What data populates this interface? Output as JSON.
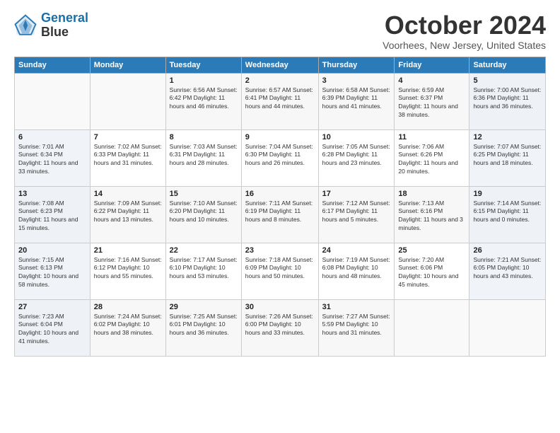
{
  "header": {
    "logo_line1": "General",
    "logo_line2": "Blue",
    "month": "October 2024",
    "location": "Voorhees, New Jersey, United States"
  },
  "days_of_week": [
    "Sunday",
    "Monday",
    "Tuesday",
    "Wednesday",
    "Thursday",
    "Friday",
    "Saturday"
  ],
  "weeks": [
    [
      {
        "day": "",
        "info": ""
      },
      {
        "day": "",
        "info": ""
      },
      {
        "day": "1",
        "info": "Sunrise: 6:56 AM\nSunset: 6:42 PM\nDaylight: 11 hours and 46 minutes."
      },
      {
        "day": "2",
        "info": "Sunrise: 6:57 AM\nSunset: 6:41 PM\nDaylight: 11 hours and 44 minutes."
      },
      {
        "day": "3",
        "info": "Sunrise: 6:58 AM\nSunset: 6:39 PM\nDaylight: 11 hours and 41 minutes."
      },
      {
        "day": "4",
        "info": "Sunrise: 6:59 AM\nSunset: 6:37 PM\nDaylight: 11 hours and 38 minutes."
      },
      {
        "day": "5",
        "info": "Sunrise: 7:00 AM\nSunset: 6:36 PM\nDaylight: 11 hours and 36 minutes."
      }
    ],
    [
      {
        "day": "6",
        "info": "Sunrise: 7:01 AM\nSunset: 6:34 PM\nDaylight: 11 hours and 33 minutes."
      },
      {
        "day": "7",
        "info": "Sunrise: 7:02 AM\nSunset: 6:33 PM\nDaylight: 11 hours and 31 minutes."
      },
      {
        "day": "8",
        "info": "Sunrise: 7:03 AM\nSunset: 6:31 PM\nDaylight: 11 hours and 28 minutes."
      },
      {
        "day": "9",
        "info": "Sunrise: 7:04 AM\nSunset: 6:30 PM\nDaylight: 11 hours and 26 minutes."
      },
      {
        "day": "10",
        "info": "Sunrise: 7:05 AM\nSunset: 6:28 PM\nDaylight: 11 hours and 23 minutes."
      },
      {
        "day": "11",
        "info": "Sunrise: 7:06 AM\nSunset: 6:26 PM\nDaylight: 11 hours and 20 minutes."
      },
      {
        "day": "12",
        "info": "Sunrise: 7:07 AM\nSunset: 6:25 PM\nDaylight: 11 hours and 18 minutes."
      }
    ],
    [
      {
        "day": "13",
        "info": "Sunrise: 7:08 AM\nSunset: 6:23 PM\nDaylight: 11 hours and 15 minutes."
      },
      {
        "day": "14",
        "info": "Sunrise: 7:09 AM\nSunset: 6:22 PM\nDaylight: 11 hours and 13 minutes."
      },
      {
        "day": "15",
        "info": "Sunrise: 7:10 AM\nSunset: 6:20 PM\nDaylight: 11 hours and 10 minutes."
      },
      {
        "day": "16",
        "info": "Sunrise: 7:11 AM\nSunset: 6:19 PM\nDaylight: 11 hours and 8 minutes."
      },
      {
        "day": "17",
        "info": "Sunrise: 7:12 AM\nSunset: 6:17 PM\nDaylight: 11 hours and 5 minutes."
      },
      {
        "day": "18",
        "info": "Sunrise: 7:13 AM\nSunset: 6:16 PM\nDaylight: 11 hours and 3 minutes."
      },
      {
        "day": "19",
        "info": "Sunrise: 7:14 AM\nSunset: 6:15 PM\nDaylight: 11 hours and 0 minutes."
      }
    ],
    [
      {
        "day": "20",
        "info": "Sunrise: 7:15 AM\nSunset: 6:13 PM\nDaylight: 10 hours and 58 minutes."
      },
      {
        "day": "21",
        "info": "Sunrise: 7:16 AM\nSunset: 6:12 PM\nDaylight: 10 hours and 55 minutes."
      },
      {
        "day": "22",
        "info": "Sunrise: 7:17 AM\nSunset: 6:10 PM\nDaylight: 10 hours and 53 minutes."
      },
      {
        "day": "23",
        "info": "Sunrise: 7:18 AM\nSunset: 6:09 PM\nDaylight: 10 hours and 50 minutes."
      },
      {
        "day": "24",
        "info": "Sunrise: 7:19 AM\nSunset: 6:08 PM\nDaylight: 10 hours and 48 minutes."
      },
      {
        "day": "25",
        "info": "Sunrise: 7:20 AM\nSunset: 6:06 PM\nDaylight: 10 hours and 45 minutes."
      },
      {
        "day": "26",
        "info": "Sunrise: 7:21 AM\nSunset: 6:05 PM\nDaylight: 10 hours and 43 minutes."
      }
    ],
    [
      {
        "day": "27",
        "info": "Sunrise: 7:23 AM\nSunset: 6:04 PM\nDaylight: 10 hours and 41 minutes."
      },
      {
        "day": "28",
        "info": "Sunrise: 7:24 AM\nSunset: 6:02 PM\nDaylight: 10 hours and 38 minutes."
      },
      {
        "day": "29",
        "info": "Sunrise: 7:25 AM\nSunset: 6:01 PM\nDaylight: 10 hours and 36 minutes."
      },
      {
        "day": "30",
        "info": "Sunrise: 7:26 AM\nSunset: 6:00 PM\nDaylight: 10 hours and 33 minutes."
      },
      {
        "day": "31",
        "info": "Sunrise: 7:27 AM\nSunset: 5:59 PM\nDaylight: 10 hours and 31 minutes."
      },
      {
        "day": "",
        "info": ""
      },
      {
        "day": "",
        "info": ""
      }
    ]
  ]
}
